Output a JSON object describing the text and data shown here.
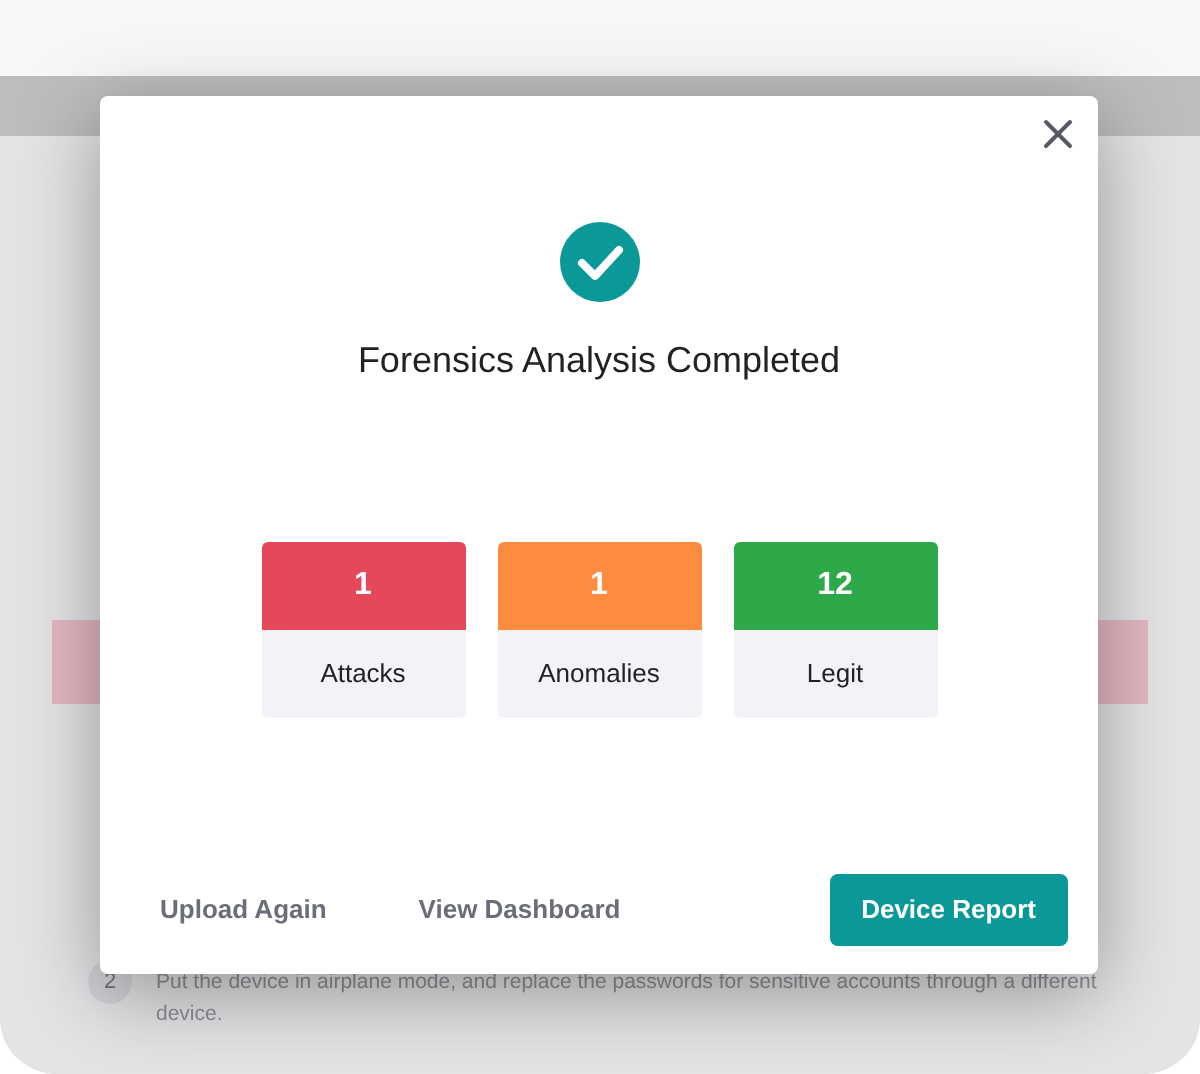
{
  "background": {
    "step": {
      "number": "2",
      "text": "Put the device in airplane mode, and replace the passwords for sensitive accounts through a different device."
    }
  },
  "modal": {
    "title": "Forensics Analysis Completed",
    "stats": [
      {
        "value": "1",
        "label": "Attacks",
        "color": "#e5485a"
      },
      {
        "value": "1",
        "label": "Anomalies",
        "color": "#fd8c3e"
      },
      {
        "value": "12",
        "label": "Legit",
        "color": "#2ea94a"
      }
    ],
    "actions": [
      {
        "label": "Upload Again",
        "kind": "link"
      },
      {
        "label": "View Dashboard",
        "kind": "link"
      },
      {
        "label": "Device Report",
        "kind": "primary"
      }
    ]
  }
}
